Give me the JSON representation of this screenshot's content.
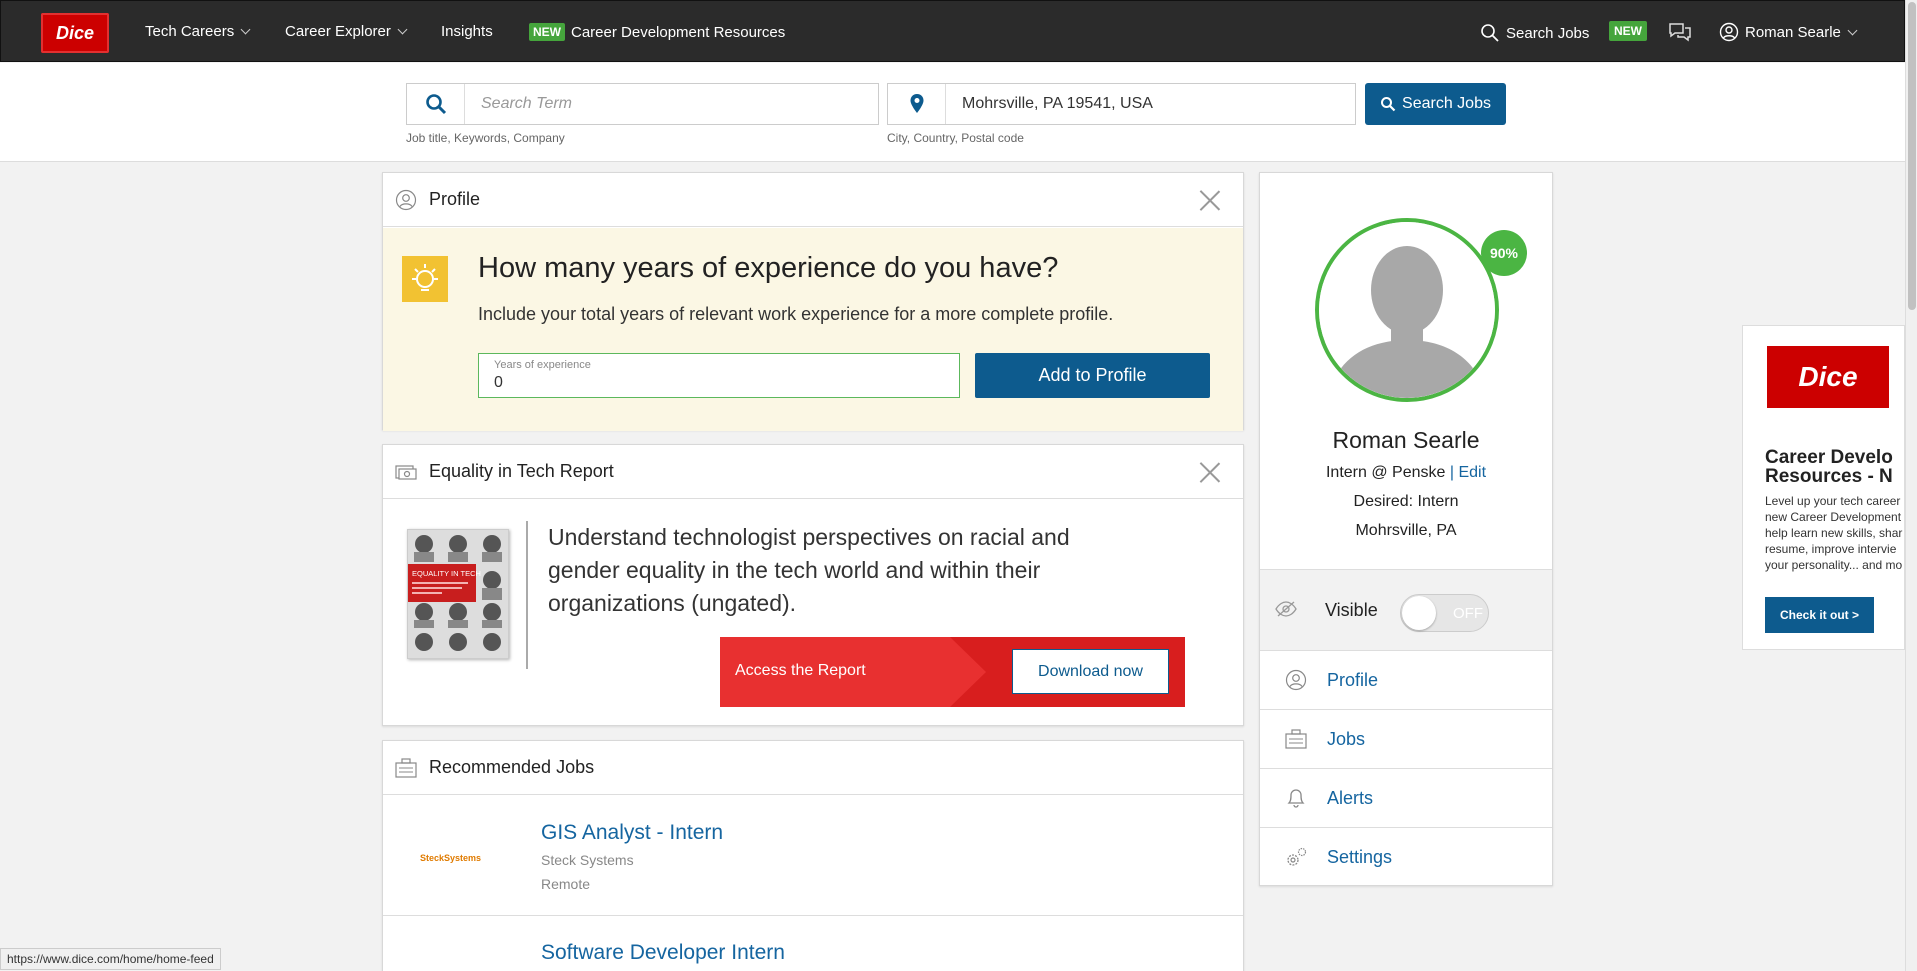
{
  "nav": {
    "logo": "Dice",
    "items": [
      {
        "label": "Tech Careers"
      },
      {
        "label": "Career Explorer"
      },
      {
        "label": "Insights"
      },
      {
        "label": "Career Development Resources"
      }
    ],
    "new_badge": "NEW",
    "search_jobs": "Search Jobs",
    "new_badge2": "NEW",
    "user_name": "Roman Searle"
  },
  "search": {
    "term_placeholder": "Search Term",
    "term_hint": "Job title, Keywords, Company",
    "location_value": "Mohrsville, PA 19541, USA",
    "location_hint": "City, Country, Postal code",
    "button_label": "Search Jobs"
  },
  "profile_card": {
    "title": "Profile",
    "question": "How many years of experience do you have?",
    "subtext": "Include your total years of relevant work experience for a more complete profile.",
    "years_label": "Years of experience",
    "years_value": "0",
    "add_button": "Add to Profile"
  },
  "equality_card": {
    "title": "Equality in Tech Report",
    "cover_title": "EQUALITY IN TECH",
    "description": "Understand technologist perspectives on racial and gender equality in the tech world and within their organizations (ungated).",
    "banner_text": "Access the Report",
    "download_button": "Download now"
  },
  "jobs_card": {
    "title": "Recommended Jobs",
    "jobs": [
      {
        "title": "GIS Analyst - Intern",
        "company": "Steck Systems",
        "location": "Remote",
        "logo_text": "SteckSystems"
      },
      {
        "title": "Software Developer Intern"
      }
    ]
  },
  "sidebar": {
    "completion": "90%",
    "name": "Roman Searle",
    "position": "Intern @ Penske",
    "sep": "|",
    "edit": "Edit",
    "desired": "Desired: Intern",
    "location": "Mohrsville, PA",
    "visible_label": "Visible",
    "toggle_state": "OFF",
    "menu": [
      {
        "label": "Profile",
        "icon": "profile-icon"
      },
      {
        "label": "Jobs",
        "icon": "briefcase-icon"
      },
      {
        "label": "Alerts",
        "icon": "bell-icon"
      },
      {
        "label": "Settings",
        "icon": "gear-icon"
      }
    ]
  },
  "ad": {
    "logo": "Dice",
    "title": "Career Develo\nResources - N",
    "text": "Level up your tech career\nnew Career Development\nhelp learn new skills, shar\nresume, improve intervie\nyour personality... and mo",
    "button": "Check it out >"
  },
  "status_url": "https://www.dice.com/home/home-feed",
  "colors": {
    "brand_red": "#cc0000",
    "primary_blue": "#0d5b8e",
    "link_blue": "#1565a0",
    "success_green": "#4bb543",
    "nav_bg": "#2b2b2b"
  }
}
